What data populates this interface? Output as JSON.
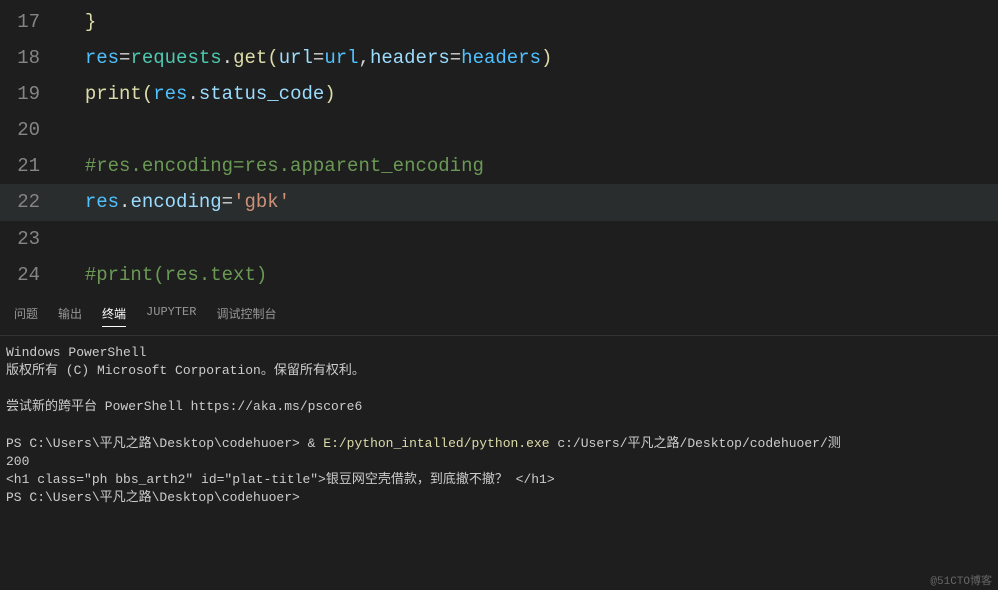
{
  "editor": {
    "lines": [
      {
        "num": "17",
        "highlight": false,
        "indent": "  ",
        "tokens": [
          {
            "cls": "kw-yellow",
            "t": "}"
          }
        ]
      },
      {
        "num": "18",
        "highlight": false,
        "indent": "  ",
        "tokens": [
          {
            "cls": "kw-blue",
            "t": "res"
          },
          {
            "cls": "kw-default",
            "t": "="
          },
          {
            "cls": "kw-teal",
            "t": "requests"
          },
          {
            "cls": "kw-default",
            "t": "."
          },
          {
            "cls": "kw-yellow",
            "t": "get"
          },
          {
            "cls": "kw-yellow",
            "t": "("
          },
          {
            "cls": "kw-cyan",
            "t": "url"
          },
          {
            "cls": "kw-default",
            "t": "="
          },
          {
            "cls": "kw-blue",
            "t": "url"
          },
          {
            "cls": "kw-default",
            "t": ","
          },
          {
            "cls": "kw-cyan",
            "t": "headers"
          },
          {
            "cls": "kw-default",
            "t": "="
          },
          {
            "cls": "kw-blue",
            "t": "headers"
          },
          {
            "cls": "kw-yellow",
            "t": ")"
          }
        ]
      },
      {
        "num": "19",
        "highlight": false,
        "indent": "  ",
        "tokens": [
          {
            "cls": "kw-yellow",
            "t": "print"
          },
          {
            "cls": "kw-yellow",
            "t": "("
          },
          {
            "cls": "kw-blue",
            "t": "res"
          },
          {
            "cls": "kw-default",
            "t": "."
          },
          {
            "cls": "kw-cyan",
            "t": "status_code"
          },
          {
            "cls": "kw-yellow",
            "t": ")"
          }
        ]
      },
      {
        "num": "20",
        "highlight": false,
        "indent": "",
        "tokens": []
      },
      {
        "num": "21",
        "highlight": false,
        "indent": "  ",
        "tokens": [
          {
            "cls": "kw-green",
            "t": "#res.encoding=res.apparent_encoding"
          }
        ]
      },
      {
        "num": "22",
        "highlight": true,
        "indent": "  ",
        "tokens": [
          {
            "cls": "kw-blue",
            "t": "res"
          },
          {
            "cls": "kw-default",
            "t": "."
          },
          {
            "cls": "kw-cyan",
            "t": "encoding"
          },
          {
            "cls": "kw-default",
            "t": "="
          },
          {
            "cls": "kw-orange",
            "t": "'gbk'"
          }
        ]
      },
      {
        "num": "23",
        "highlight": false,
        "indent": "",
        "tokens": []
      },
      {
        "num": "24",
        "highlight": false,
        "indent": "  ",
        "tokens": [
          {
            "cls": "kw-green",
            "t": "#print(res.text)"
          }
        ]
      }
    ]
  },
  "panel_tabs": {
    "problems": "问题",
    "output": "输出",
    "terminal": "终端",
    "jupyter": "JUPYTER",
    "debug": "调试控制台"
  },
  "terminal": {
    "ps_title": "Windows PowerShell",
    "copyright": "版权所有 (C) Microsoft Corporation。保留所有权利。",
    "pscore_msg": "尝试新的跨平台 PowerShell https://aka.ms/pscore6",
    "prompt1": "PS C:\\Users\\平凡之路\\Desktop\\codehuoer> ",
    "cmd_amp": "& ",
    "cmd_exec": "E:/python_intalled/python.exe",
    "cmd_args": " c:/Users/平凡之路/Desktop/codehuoer/测",
    "out_200": "200",
    "out_html": "<h1 class=\"ph bbs_arth2\" id=\"plat-title\">银豆网空壳借款，到底撤不撤？ </h1>",
    "prompt2": "PS C:\\Users\\平凡之路\\Desktop\\codehuoer>"
  },
  "watermark": "@51CTO博客"
}
